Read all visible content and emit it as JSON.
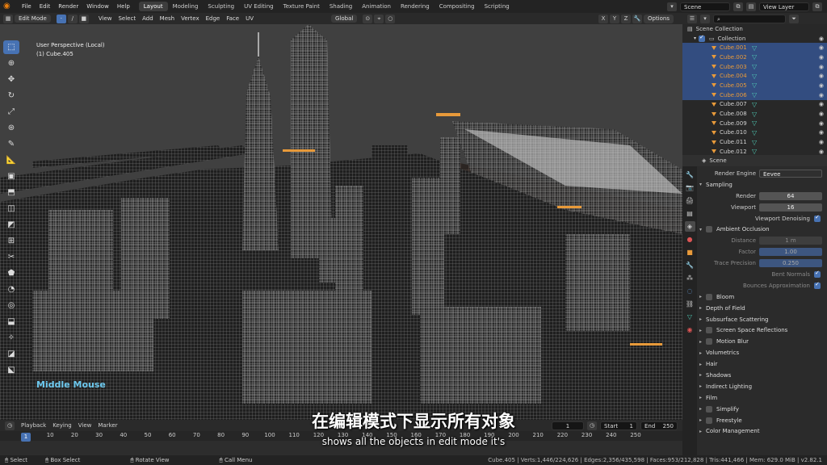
{
  "topbar": {
    "menus": [
      "File",
      "Edit",
      "Render",
      "Window",
      "Help"
    ],
    "workspaces": [
      "Layout",
      "Modeling",
      "Sculpting",
      "UV Editing",
      "Texture Paint",
      "Shading",
      "Animation",
      "Rendering",
      "Compositing",
      "Scripting"
    ],
    "scene": "Scene",
    "view_layer": "View Layer"
  },
  "viewport": {
    "mode": "Edit Mode",
    "menus": [
      "View",
      "Select",
      "Add",
      "Mesh",
      "Vertex",
      "Edge",
      "Face",
      "UV"
    ],
    "orientation": "Global",
    "options_label": "Options",
    "axes": [
      "X",
      "Y",
      "Z"
    ],
    "perspective": "User Perspective (Local)",
    "object": "(1) Cube.405",
    "overlay_text": "Middle Mouse"
  },
  "outliner": {
    "search_placeholder": "",
    "root": "Scene Collection",
    "collection": "Collection",
    "items": [
      {
        "name": "Cube.001",
        "selected": true
      },
      {
        "name": "Cube.002",
        "selected": true
      },
      {
        "name": "Cube.003",
        "selected": true
      },
      {
        "name": "Cube.004",
        "selected": true
      },
      {
        "name": "Cube.005",
        "selected": true
      },
      {
        "name": "Cube.006",
        "selected": true
      },
      {
        "name": "Cube.007",
        "selected": false
      },
      {
        "name": "Cube.008",
        "selected": false
      },
      {
        "name": "Cube.009",
        "selected": false
      },
      {
        "name": "Cube.010",
        "selected": false
      },
      {
        "name": "Cube.011",
        "selected": false
      },
      {
        "name": "Cube.012",
        "selected": false
      }
    ]
  },
  "properties": {
    "header": "Scene",
    "render_engine_label": "Render Engine",
    "render_engine": "Eevee",
    "sampling": "Sampling",
    "render_label": "Render",
    "render_value": "64",
    "viewport_label": "Viewport",
    "viewport_value": "16",
    "viewport_denoising": "Viewport Denoising",
    "ambient_occlusion": "Ambient Occlusion",
    "distance_label": "Distance",
    "distance_value": "1 m",
    "factor_label": "Factor",
    "factor_value": "1.00",
    "trace_precision_label": "Trace Precision",
    "trace_precision_value": "0.250",
    "bent_normals": "Bent Normals",
    "bounces_approximation": "Bounces Approximation",
    "panels": [
      {
        "label": "Bloom",
        "checkbox": true
      },
      {
        "label": "Depth of Field",
        "checkbox": false
      },
      {
        "label": "Subsurface Scattering",
        "checkbox": false
      },
      {
        "label": "Screen Space Reflections",
        "checkbox": true
      },
      {
        "label": "Motion Blur",
        "checkbox": true
      },
      {
        "label": "Volumetrics",
        "checkbox": false
      },
      {
        "label": "Hair",
        "checkbox": false
      },
      {
        "label": "Shadows",
        "checkbox": false
      },
      {
        "label": "Indirect Lighting",
        "checkbox": false
      },
      {
        "label": "Film",
        "checkbox": false
      },
      {
        "label": "Simplify",
        "checkbox": true
      },
      {
        "label": "Freestyle",
        "checkbox": true
      },
      {
        "label": "Color Management",
        "checkbox": false
      }
    ]
  },
  "timeline": {
    "menus": [
      "Playback",
      "Keying",
      "View",
      "Marker"
    ],
    "current_frame": "1",
    "start_label": "Start",
    "start": "1",
    "end_label": "End",
    "end": "250",
    "ticks": [
      "1",
      "10",
      "20",
      "30",
      "40",
      "50",
      "60",
      "70",
      "80",
      "90",
      "100",
      "110",
      "120",
      "130",
      "140",
      "150",
      "160",
      "170",
      "180",
      "190",
      "200",
      "210",
      "220",
      "230",
      "240",
      "250"
    ]
  },
  "statusbar": {
    "items": [
      "Select",
      "Box Select",
      "Rotate View",
      "Call Menu"
    ],
    "stats": "Cube.405 | Verts:1,446/224,626 | Edges:2,356/435,598 | Faces:953/212,828 | Tris:441,466 | Mem: 629.0 MiB | v2.82.1"
  },
  "subtitles": {
    "chinese": "在编辑模式下显示所有对象",
    "english": "shows all the objects in edit mode it's"
  },
  "colors": {
    "accent": "#4772b3",
    "selected_object": "#e89a3a",
    "mesh_icon": "#4ec7b2",
    "overlay_text": "#6cc8ee"
  }
}
